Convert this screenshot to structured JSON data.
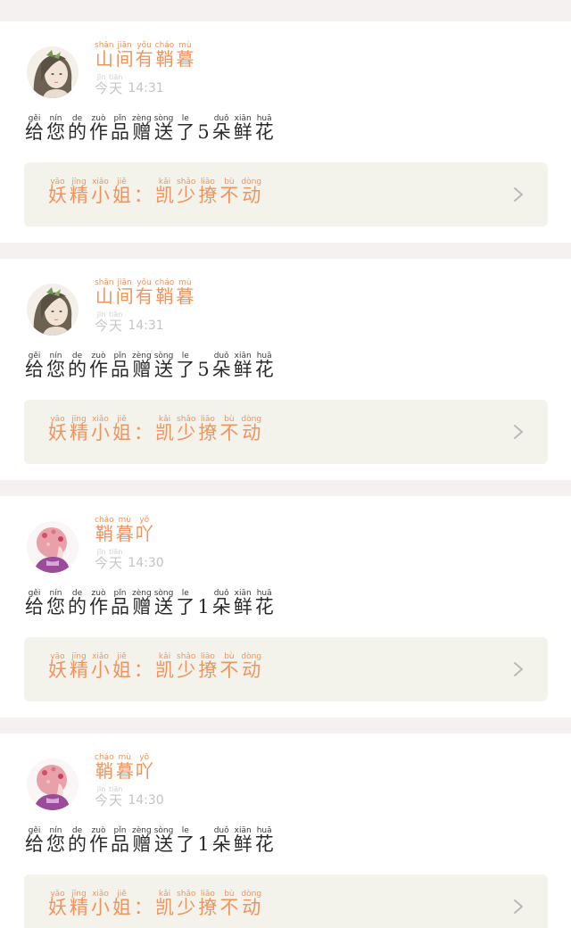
{
  "feed": {
    "items": [
      {
        "avatar_icon": "girl-portrait-icon",
        "user_name": [
          [
            "shān",
            "山"
          ],
          [
            "jiān",
            "间"
          ],
          [
            "yǒu",
            "有"
          ],
          [
            "cháo",
            "鞘"
          ],
          [
            "mù",
            "暮"
          ]
        ],
        "day_label": [
          [
            "jīn",
            "今"
          ],
          [
            "tiān",
            "天"
          ]
        ],
        "time": "14:31",
        "message": [
          [
            "gěi",
            "给"
          ],
          [
            "nín",
            "您"
          ],
          [
            "de",
            "的"
          ],
          [
            "zuò",
            "作"
          ],
          [
            "pǐn",
            "品"
          ],
          [
            "zèng",
            "赠"
          ],
          [
            "sòng",
            "送"
          ],
          [
            "le",
            "了"
          ],
          [
            "",
            "5"
          ],
          [
            "duǒ",
            "朵"
          ],
          [
            "xiān",
            "鲜"
          ],
          [
            "huā",
            "花"
          ]
        ],
        "quote_title": [
          [
            "yāo",
            "妖"
          ],
          [
            "jīng",
            "精"
          ],
          [
            "xiǎo",
            "小"
          ],
          [
            "jiě",
            "姐"
          ],
          [
            "",
            "："
          ],
          [
            "kǎi",
            "凯"
          ],
          [
            "shǎo",
            "少"
          ],
          [
            "liāo",
            "撩"
          ],
          [
            "bù",
            "不"
          ],
          [
            "dòng",
            "动"
          ]
        ],
        "chevron_icon": "chevron-right-icon"
      },
      {
        "avatar_icon": "girl-portrait-icon",
        "user_name": [
          [
            "shān",
            "山"
          ],
          [
            "jiān",
            "间"
          ],
          [
            "yǒu",
            "有"
          ],
          [
            "cháo",
            "鞘"
          ],
          [
            "mù",
            "暮"
          ]
        ],
        "day_label": [
          [
            "jīn",
            "今"
          ],
          [
            "tiān",
            "天"
          ]
        ],
        "time": "14:31",
        "message": [
          [
            "gěi",
            "给"
          ],
          [
            "nín",
            "您"
          ],
          [
            "de",
            "的"
          ],
          [
            "zuò",
            "作"
          ],
          [
            "pǐn",
            "品"
          ],
          [
            "zèng",
            "赠"
          ],
          [
            "sòng",
            "送"
          ],
          [
            "le",
            "了"
          ],
          [
            "",
            "5"
          ],
          [
            "duǒ",
            "朵"
          ],
          [
            "xiān",
            "鲜"
          ],
          [
            "huā",
            "花"
          ]
        ],
        "quote_title": [
          [
            "yāo",
            "妖"
          ],
          [
            "jīng",
            "精"
          ],
          [
            "xiǎo",
            "小"
          ],
          [
            "jiě",
            "姐"
          ],
          [
            "",
            "："
          ],
          [
            "kǎi",
            "凯"
          ],
          [
            "shǎo",
            "少"
          ],
          [
            "liāo",
            "撩"
          ],
          [
            "bù",
            "不"
          ],
          [
            "dòng",
            "动"
          ]
        ],
        "chevron_icon": "chevron-right-icon"
      },
      {
        "avatar_icon": "girl-with-flowers-icon",
        "user_name": [
          [
            "cháo",
            "鞘"
          ],
          [
            "mù",
            "暮"
          ],
          [
            "yǒ",
            "吖"
          ]
        ],
        "day_label": [
          [
            "jīn",
            "今"
          ],
          [
            "tiān",
            "天"
          ]
        ],
        "time": "14:30",
        "message": [
          [
            "gěi",
            "给"
          ],
          [
            "nín",
            "您"
          ],
          [
            "de",
            "的"
          ],
          [
            "zuò",
            "作"
          ],
          [
            "pǐn",
            "品"
          ],
          [
            "zèng",
            "赠"
          ],
          [
            "sòng",
            "送"
          ],
          [
            "le",
            "了"
          ],
          [
            "",
            "1"
          ],
          [
            "duǒ",
            "朵"
          ],
          [
            "xiān",
            "鲜"
          ],
          [
            "huā",
            "花"
          ]
        ],
        "quote_title": [
          [
            "yāo",
            "妖"
          ],
          [
            "jīng",
            "精"
          ],
          [
            "xiǎo",
            "小"
          ],
          [
            "jiě",
            "姐"
          ],
          [
            "",
            "："
          ],
          [
            "kǎi",
            "凯"
          ],
          [
            "shǎo",
            "少"
          ],
          [
            "liāo",
            "撩"
          ],
          [
            "bù",
            "不"
          ],
          [
            "dòng",
            "动"
          ]
        ],
        "chevron_icon": "chevron-right-icon"
      },
      {
        "avatar_icon": "girl-with-flowers-icon",
        "user_name": [
          [
            "cháo",
            "鞘"
          ],
          [
            "mù",
            "暮"
          ],
          [
            "yǒ",
            "吖"
          ]
        ],
        "day_label": [
          [
            "jīn",
            "今"
          ],
          [
            "tiān",
            "天"
          ]
        ],
        "time": "14:30",
        "message": [
          [
            "gěi",
            "给"
          ],
          [
            "nín",
            "您"
          ],
          [
            "de",
            "的"
          ],
          [
            "zuò",
            "作"
          ],
          [
            "pǐn",
            "品"
          ],
          [
            "zèng",
            "赠"
          ],
          [
            "sòng",
            "送"
          ],
          [
            "le",
            "了"
          ],
          [
            "",
            "1"
          ],
          [
            "duǒ",
            "朵"
          ],
          [
            "xiān",
            "鲜"
          ],
          [
            "huā",
            "花"
          ]
        ],
        "quote_title": [
          [
            "yāo",
            "妖"
          ],
          [
            "jīng",
            "精"
          ],
          [
            "xiǎo",
            "小"
          ],
          [
            "jiě",
            "姐"
          ],
          [
            "",
            "："
          ],
          [
            "kǎi",
            "凯"
          ],
          [
            "shǎo",
            "少"
          ],
          [
            "liāo",
            "撩"
          ],
          [
            "bù",
            "不"
          ],
          [
            "dòng",
            "动"
          ]
        ],
        "chevron_icon": "chevron-right-icon"
      }
    ]
  },
  "colors": {
    "accent": "#f0935d",
    "page_background": "#f6f1f1",
    "card_background": "#ffffff",
    "quote_background": "#f3f3ec",
    "muted_text": "#c7c7c7",
    "body_text": "#2b2b2b"
  }
}
